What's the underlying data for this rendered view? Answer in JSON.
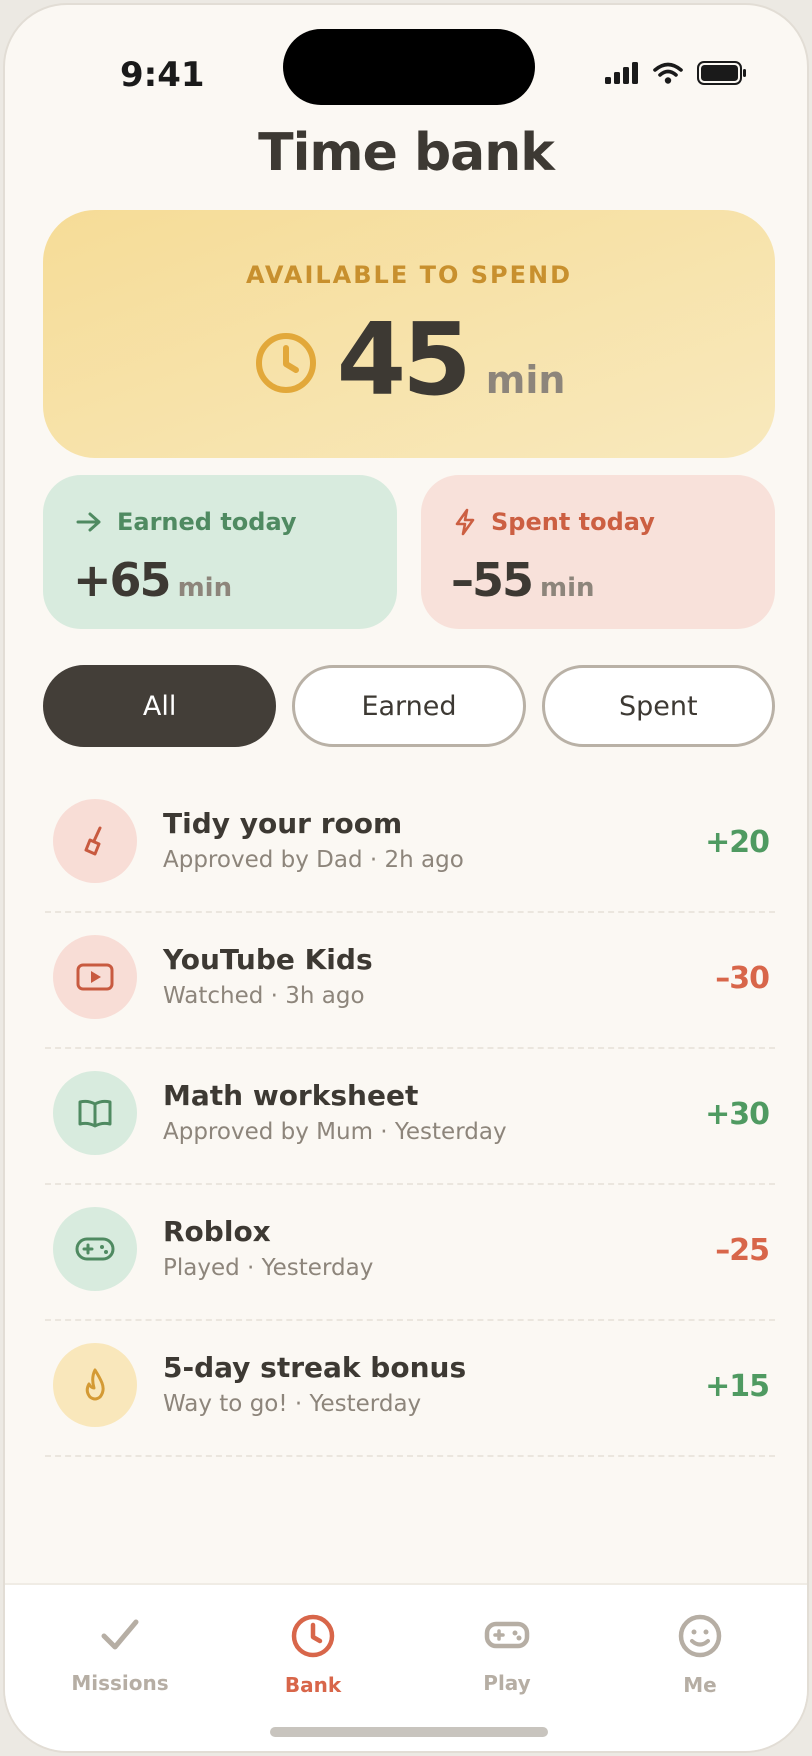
{
  "status": {
    "time": "9:41"
  },
  "page": {
    "title": "Time bank"
  },
  "balance": {
    "label": "AVAILABLE TO SPEND",
    "value": "45",
    "unit": "min"
  },
  "stats": {
    "earned": {
      "label": "Earned today",
      "value": "+65",
      "unit": "min"
    },
    "spent": {
      "label": "Spent today",
      "value": "–55",
      "unit": "min"
    }
  },
  "filters": {
    "all": "All",
    "earned": "Earned",
    "spent": "Spent",
    "selected": "All"
  },
  "transactions": [
    {
      "title": "Tidy your room",
      "subtitle": "Approved by Dad · 2h ago",
      "amount": "+20",
      "icon": "broom-icon"
    },
    {
      "title": "YouTube Kids",
      "subtitle": "Watched · 3h ago",
      "amount": "–30",
      "icon": "play-icon"
    },
    {
      "title": "Math worksheet",
      "subtitle": "Approved by Mum · Yesterday",
      "amount": "+30",
      "icon": "book-icon"
    },
    {
      "title": "Roblox",
      "subtitle": "Played · Yesterday",
      "amount": "–25",
      "icon": "gamepad-icon"
    },
    {
      "title": "5-day streak bonus",
      "subtitle": "Way to go! · Yesterday",
      "amount": "+15",
      "icon": "flame-icon"
    }
  ],
  "tabs": {
    "missions": "Missions",
    "bank": "Bank",
    "play": "Play",
    "me": "Me",
    "active": "Bank"
  },
  "colors": {
    "accent": "#d8664a",
    "positive": "#4f9a61",
    "gold": "#e2a83a",
    "dark": "#433e38"
  }
}
